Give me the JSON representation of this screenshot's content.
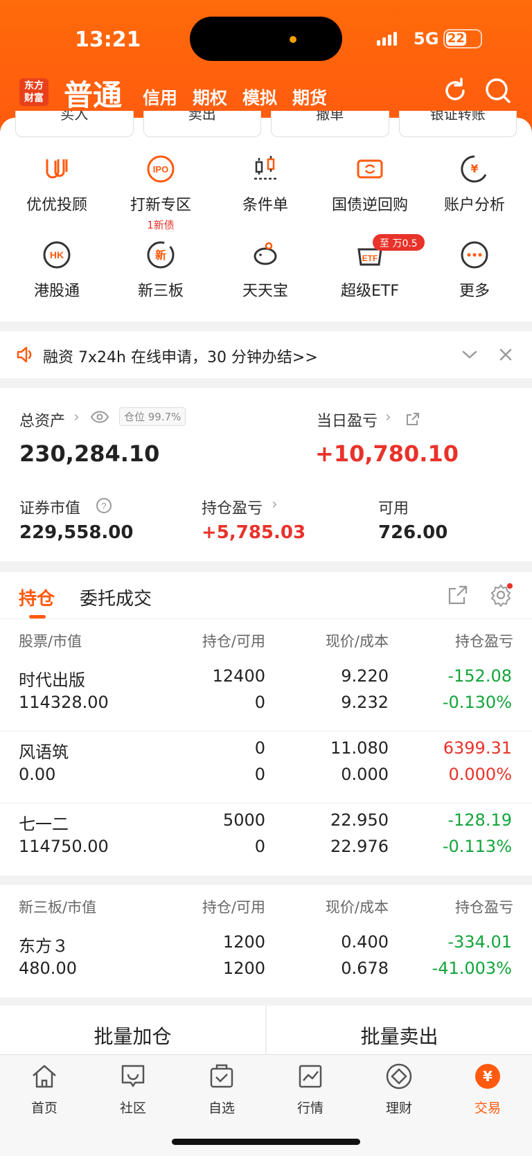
{
  "status": {
    "time": "13:21",
    "network": "5G",
    "battery": "22"
  },
  "header": {
    "logo": "东方财富",
    "title": "普通",
    "tabs": [
      "信用",
      "期权",
      "模拟",
      "期货"
    ]
  },
  "quick_actions": [
    "买入",
    "卖出",
    "撤单",
    "银证转账"
  ],
  "grid": {
    "row1": [
      {
        "label": "优优投顾",
        "icon": "uu-icon"
      },
      {
        "label": "打新专区",
        "icon": "ipo-icon",
        "sub": "1新债"
      },
      {
        "label": "条件单",
        "icon": "condition-icon"
      },
      {
        "label": "国债逆回购",
        "icon": "repo-icon"
      },
      {
        "label": "账户分析",
        "icon": "analysis-icon"
      }
    ],
    "row2": [
      {
        "label": "港股通",
        "icon": "hk-icon"
      },
      {
        "label": "新三板",
        "icon": "neeq-icon"
      },
      {
        "label": "天天宝",
        "icon": "piggy-icon"
      },
      {
        "label": "超级ETF",
        "icon": "etf-icon",
        "badge": "万0.5",
        "badge_prefix": "至"
      },
      {
        "label": "更多",
        "icon": "more-icon"
      }
    ]
  },
  "banner": {
    "text": "融资 7x24h 在线申请，30 分钟办结>>"
  },
  "assets": {
    "total_label": "总资产",
    "position_pill": "仓位 99.7%",
    "total_value": "230,284.10",
    "daily_label": "当日盈亏",
    "daily_value": "+10,780.10",
    "market_label": "证券市值",
    "market_value": "229,558.00",
    "holding_label": "持仓盈亏",
    "holding_value": "+5,785.03",
    "available_label": "可用",
    "available_value": "726.00"
  },
  "holdings": {
    "tab_active": "持仓",
    "tab_other": "委托成交",
    "headers": [
      "股票/市值",
      "持仓/可用",
      "现价/成本",
      "持仓盈亏"
    ],
    "rows": [
      {
        "name": "时代出版",
        "value": "114328.00",
        "hold": "12400",
        "avail": "0",
        "price": "9.220",
        "cost": "9.232",
        "pnl": "-152.08",
        "pct": "-0.130%",
        "color": "green"
      },
      {
        "name": "风语筑",
        "value": "0.00",
        "hold": "0",
        "avail": "0",
        "price": "11.080",
        "cost": "0.000",
        "pnl": "6399.31",
        "pct": "0.000%",
        "color": "red"
      },
      {
        "name": "七一二",
        "value": "114750.00",
        "hold": "5000",
        "avail": "0",
        "price": "22.950",
        "cost": "22.976",
        "pnl": "-128.19",
        "pct": "-0.113%",
        "color": "green"
      }
    ]
  },
  "neeq": {
    "headers": [
      "新三板/市值",
      "持仓/可用",
      "现价/成本",
      "持仓盈亏"
    ],
    "row": {
      "name": "东方３",
      "value": "480.00",
      "hold": "1200",
      "avail": "1200",
      "price": "0.400",
      "cost": "0.678",
      "pnl": "-334.01",
      "pct": "-41.003%"
    }
  },
  "batch": {
    "add": "批量加仓",
    "sell": "批量卖出"
  },
  "tabbar": [
    "首页",
    "社区",
    "自选",
    "行情",
    "理财",
    "交易"
  ],
  "colors": {
    "brand": "#ff5a0f",
    "red": "#e8322a",
    "green": "#12a53a"
  }
}
